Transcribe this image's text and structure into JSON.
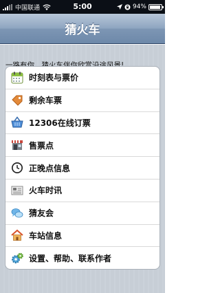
{
  "status_bar": {
    "carrier": "中国联通",
    "time": "5:00",
    "battery_percent": "94%",
    "battery_level": 0.94
  },
  "nav": {
    "title": "猜火车"
  },
  "subtitle": "一路有你，猜火车伴你欣赏沿途风景!",
  "menu": [
    {
      "label": "时刻表与票价",
      "icon": "calendar-icon"
    },
    {
      "label": "剩余车票",
      "icon": "ticket-tag-icon"
    },
    {
      "label": "12306在线订票",
      "icon": "shopping-basket-icon"
    },
    {
      "label": "售票点",
      "icon": "store-icon"
    },
    {
      "label": "正晚点信息",
      "icon": "clock-icon"
    },
    {
      "label": "火车时讯",
      "icon": "newspaper-icon"
    },
    {
      "label": "猜友会",
      "icon": "chat-bubbles-icon"
    },
    {
      "label": "车站信息",
      "icon": "house-icon"
    },
    {
      "label": "设置、帮助、联系作者",
      "icon": "gears-icon"
    }
  ]
}
